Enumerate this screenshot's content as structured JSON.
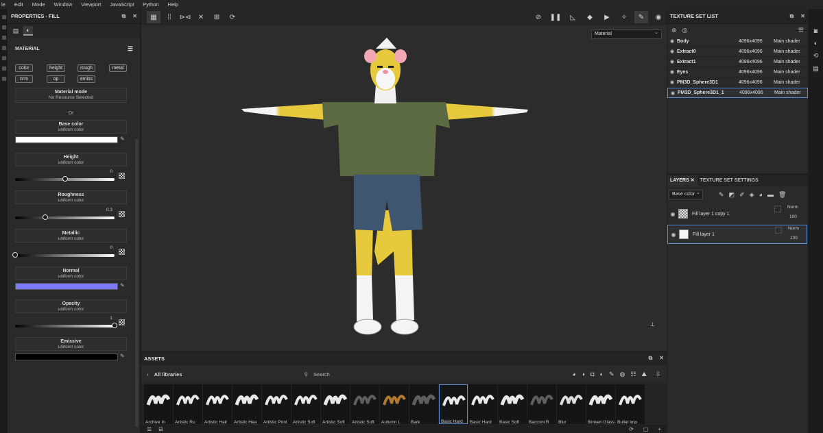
{
  "menu": [
    "le",
    "Edit",
    "Mode",
    "Window",
    "Viewport",
    "JavaScript",
    "Python",
    "Help"
  ],
  "properties": {
    "title": "PROPERTIES - FILL",
    "material_label": "MATERIAL",
    "channels": [
      "color",
      "height",
      "rough",
      "metal",
      "nrm",
      "op",
      "emiss"
    ],
    "material_mode": {
      "title": "Material mode",
      "sub": "No Resource Selected"
    },
    "or_label": "Or",
    "base_color": {
      "title": "Base color",
      "sub": "uniform color",
      "color": "#ffffff"
    },
    "height": {
      "title": "Height",
      "sub": "uniform color",
      "value": "0",
      "level": 0.5
    },
    "roughness": {
      "title": "Roughness",
      "sub": "uniform color",
      "value": "0.3",
      "level": 0.3
    },
    "metallic": {
      "title": "Metallic",
      "sub": "uniform color",
      "value": "0",
      "level": 0
    },
    "normal": {
      "title": "Normal",
      "sub": "uniform color",
      "color": "#7b7bf7"
    },
    "opacity": {
      "title": "Opacity",
      "sub": "uniform color",
      "value": "1",
      "level": 1
    },
    "emissive": {
      "title": "Emissive",
      "sub": "uniform color",
      "color": "#000000"
    }
  },
  "viewport": {
    "mode": "Material"
  },
  "assets": {
    "title": "ASSETS",
    "library": "All libraries",
    "search_placeholder": "Search",
    "items": [
      "Archive In",
      "Artistic Ru",
      "Artistic Hair",
      "Artistic Hea",
      "Artistic Print",
      "Artistic Soft",
      "Artistic Soft",
      "Artistic Soft",
      "Autumn L",
      "Bark",
      "Basic Hard",
      "Basic Hard",
      "Basic Soft",
      "Bacconi R",
      "Blur",
      "Broken Glass",
      "Bullet Imp"
    ]
  },
  "texture_sets": {
    "title": "TEXTURE SET LIST",
    "rows": [
      {
        "name": "Body",
        "res": "4096x4096",
        "shader": "Main shader"
      },
      {
        "name": "Extract0",
        "res": "4096x4096",
        "shader": "Main shader"
      },
      {
        "name": "Extract1",
        "res": "4096x4096",
        "shader": "Main shader"
      },
      {
        "name": "Eyes",
        "res": "4096x4096",
        "shader": "Main shader"
      },
      {
        "name": "PM3D_Sphere3D1",
        "res": "4096x4096",
        "shader": "Main shader"
      },
      {
        "name": "PM3D_Sphere3D1_1",
        "res": "4096x4096",
        "shader": "Main shader"
      }
    ]
  },
  "layers": {
    "tab_layers": "LAYERS",
    "tab_settings": "TEXTURE SET SETTINGS",
    "channel": "Base color",
    "rows": [
      {
        "name": "Fill layer 1 copy 1",
        "blend": "Norm",
        "opacity": "100"
      },
      {
        "name": "Fill layer 1",
        "blend": "Norm",
        "opacity": "100"
      }
    ]
  }
}
